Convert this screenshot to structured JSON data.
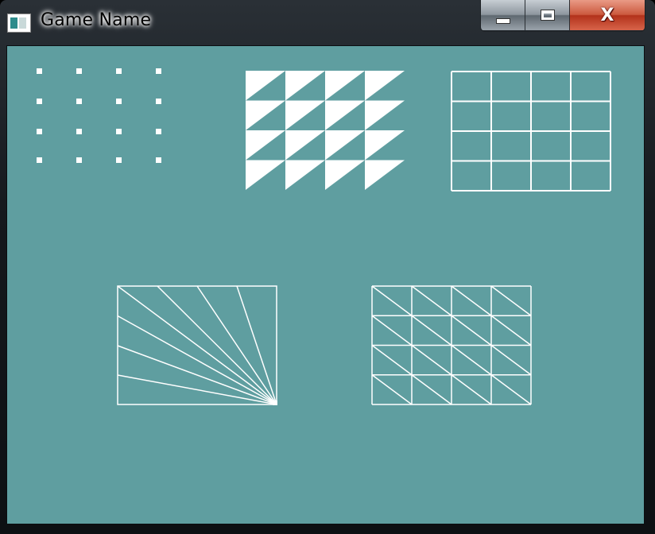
{
  "window": {
    "title": "Game Name",
    "controls": {
      "minimize": "minimize",
      "maximize": "maximize",
      "close": "X"
    }
  },
  "colors": {
    "background": "#5f9ea0",
    "shapes": "#ffffff"
  },
  "drawings": {
    "points_demo": "point-list",
    "filled_triangles_demo": "triangle-list",
    "grid_lines_demo": "line-list",
    "fan_demo": "triangle-fan",
    "wireframe_triangles_demo": "triangle-wireframe"
  }
}
